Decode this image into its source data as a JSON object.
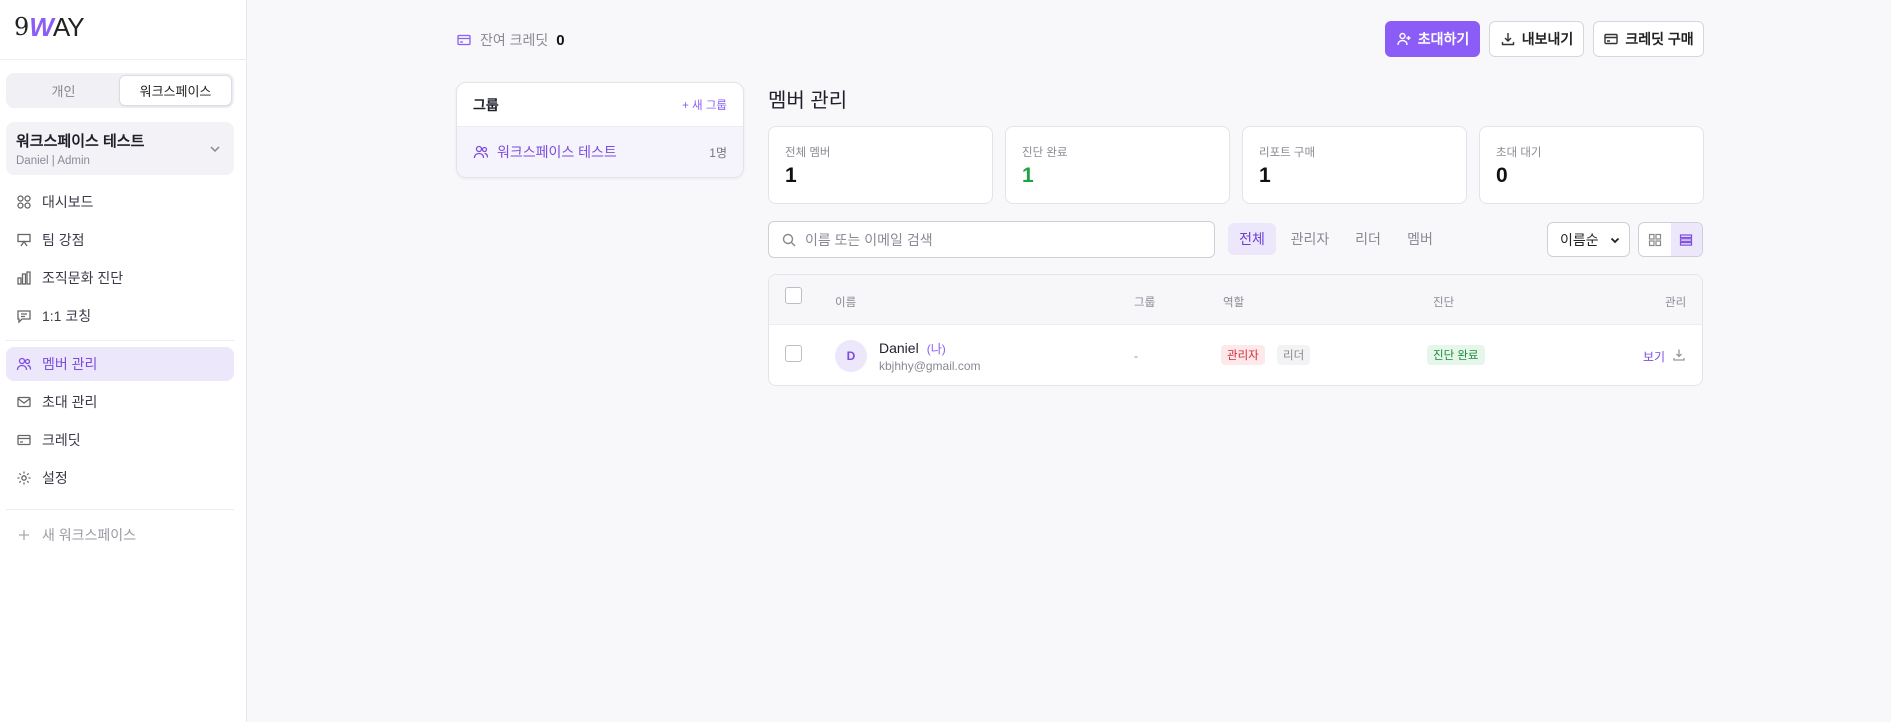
{
  "logo": {
    "nine": "9",
    "w": "W",
    "ay": "AY"
  },
  "sidebar": {
    "toggle": {
      "personal": "개인",
      "workspace": "워크스페이스"
    },
    "workspace": {
      "name": "워크스페이스 테스트",
      "sub": "Daniel | Admin"
    },
    "nav": [
      {
        "label": "대시보드",
        "icon": "grid-icon"
      },
      {
        "label": "팀 강점",
        "icon": "presentation-icon"
      },
      {
        "label": "조직문화 진단",
        "icon": "bar-chart-icon"
      },
      {
        "label": "1:1 코칭",
        "icon": "chat-icon"
      },
      {
        "label": "멤버 관리",
        "icon": "users-icon"
      },
      {
        "label": "초대 관리",
        "icon": "mail-icon"
      },
      {
        "label": "크레딧",
        "icon": "credit-card-icon"
      },
      {
        "label": "설정",
        "icon": "gear-icon"
      }
    ],
    "new_workspace": "새 워크스페이스"
  },
  "header": {
    "credit_label": "잔여 크레딧",
    "credit_value": "0",
    "invite_button": "초대하기",
    "export_button": "내보내기",
    "buy_credit_button": "크레딧 구매"
  },
  "groups": {
    "title": "그룹",
    "new_group": "+ 새 그룹",
    "items": [
      {
        "name": "워크스페이스 테스트",
        "count": "1명"
      }
    ]
  },
  "page": {
    "title": "멤버 관리"
  },
  "stats": [
    {
      "label": "전체 멤버",
      "value": "1"
    },
    {
      "label": "진단 완료",
      "value": "1"
    },
    {
      "label": "리포트 구매",
      "value": "1"
    },
    {
      "label": "초대 대기",
      "value": "0"
    }
  ],
  "search": {
    "placeholder": "이름 또는 이메일 검색"
  },
  "filters": [
    "전체",
    "관리자",
    "리더",
    "멤버"
  ],
  "sort": {
    "selected": "이름순"
  },
  "table": {
    "headers": {
      "name": "이름",
      "group": "그룹",
      "role": "역할",
      "diagnosis": "진단",
      "manage": "관리"
    },
    "rows": [
      {
        "initial": "D",
        "name": "Daniel",
        "me": "(나)",
        "email": "kbjhhy@gmail.com",
        "group": "-",
        "role": "관리자",
        "tag": "리더",
        "diagnosis": "진단 완료",
        "view": "보기"
      }
    ]
  },
  "colors": {
    "accent": "#8b5cf6",
    "accent_light": "#ede7fb",
    "success": "#22a145",
    "danger": "#d02a3a"
  }
}
